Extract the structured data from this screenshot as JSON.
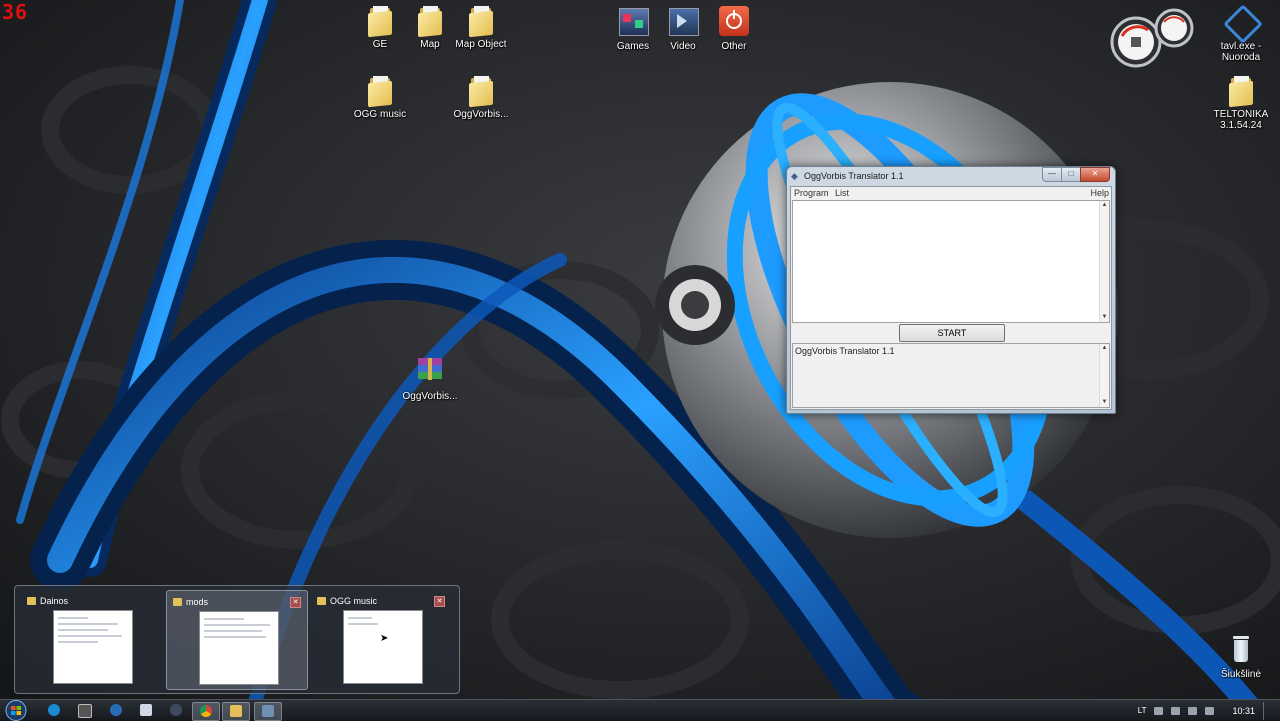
{
  "fps_counter": "36",
  "desktop_icons": [
    {
      "label": "GE"
    },
    {
      "label": "Map"
    },
    {
      "label": "Map Object"
    },
    {
      "label": "OGG music"
    },
    {
      "label": "OggVorbis..."
    },
    {
      "label": "Games"
    },
    {
      "label": "Video"
    },
    {
      "label": "Other"
    },
    {
      "label": "OggVorbis..."
    },
    {
      "label": "tavl.exe - Nuoroda"
    },
    {
      "label": "TELTONIKA 3.1.54.24"
    },
    {
      "label": "Šiukšlinė"
    }
  ],
  "window": {
    "title": "OggVorbis Translator 1.1",
    "menu": {
      "program": "Program",
      "list": "List",
      "help": "Help"
    },
    "start_label": "START",
    "log_text": "OggVorbis Translator 1.1",
    "buttons": {
      "minimize": "—",
      "maximize": "□",
      "close": "✕"
    }
  },
  "thumbnails": [
    {
      "title": "Dainos"
    },
    {
      "title": "mods"
    },
    {
      "title": "OGG music"
    }
  ],
  "thumb_close": "✕",
  "tray": {
    "language": "LT",
    "time": "10:31"
  },
  "colors": {
    "accent_blue": "#1b8fff",
    "desktop_bg": "#1e1f21",
    "fps_red": "#e01010"
  }
}
